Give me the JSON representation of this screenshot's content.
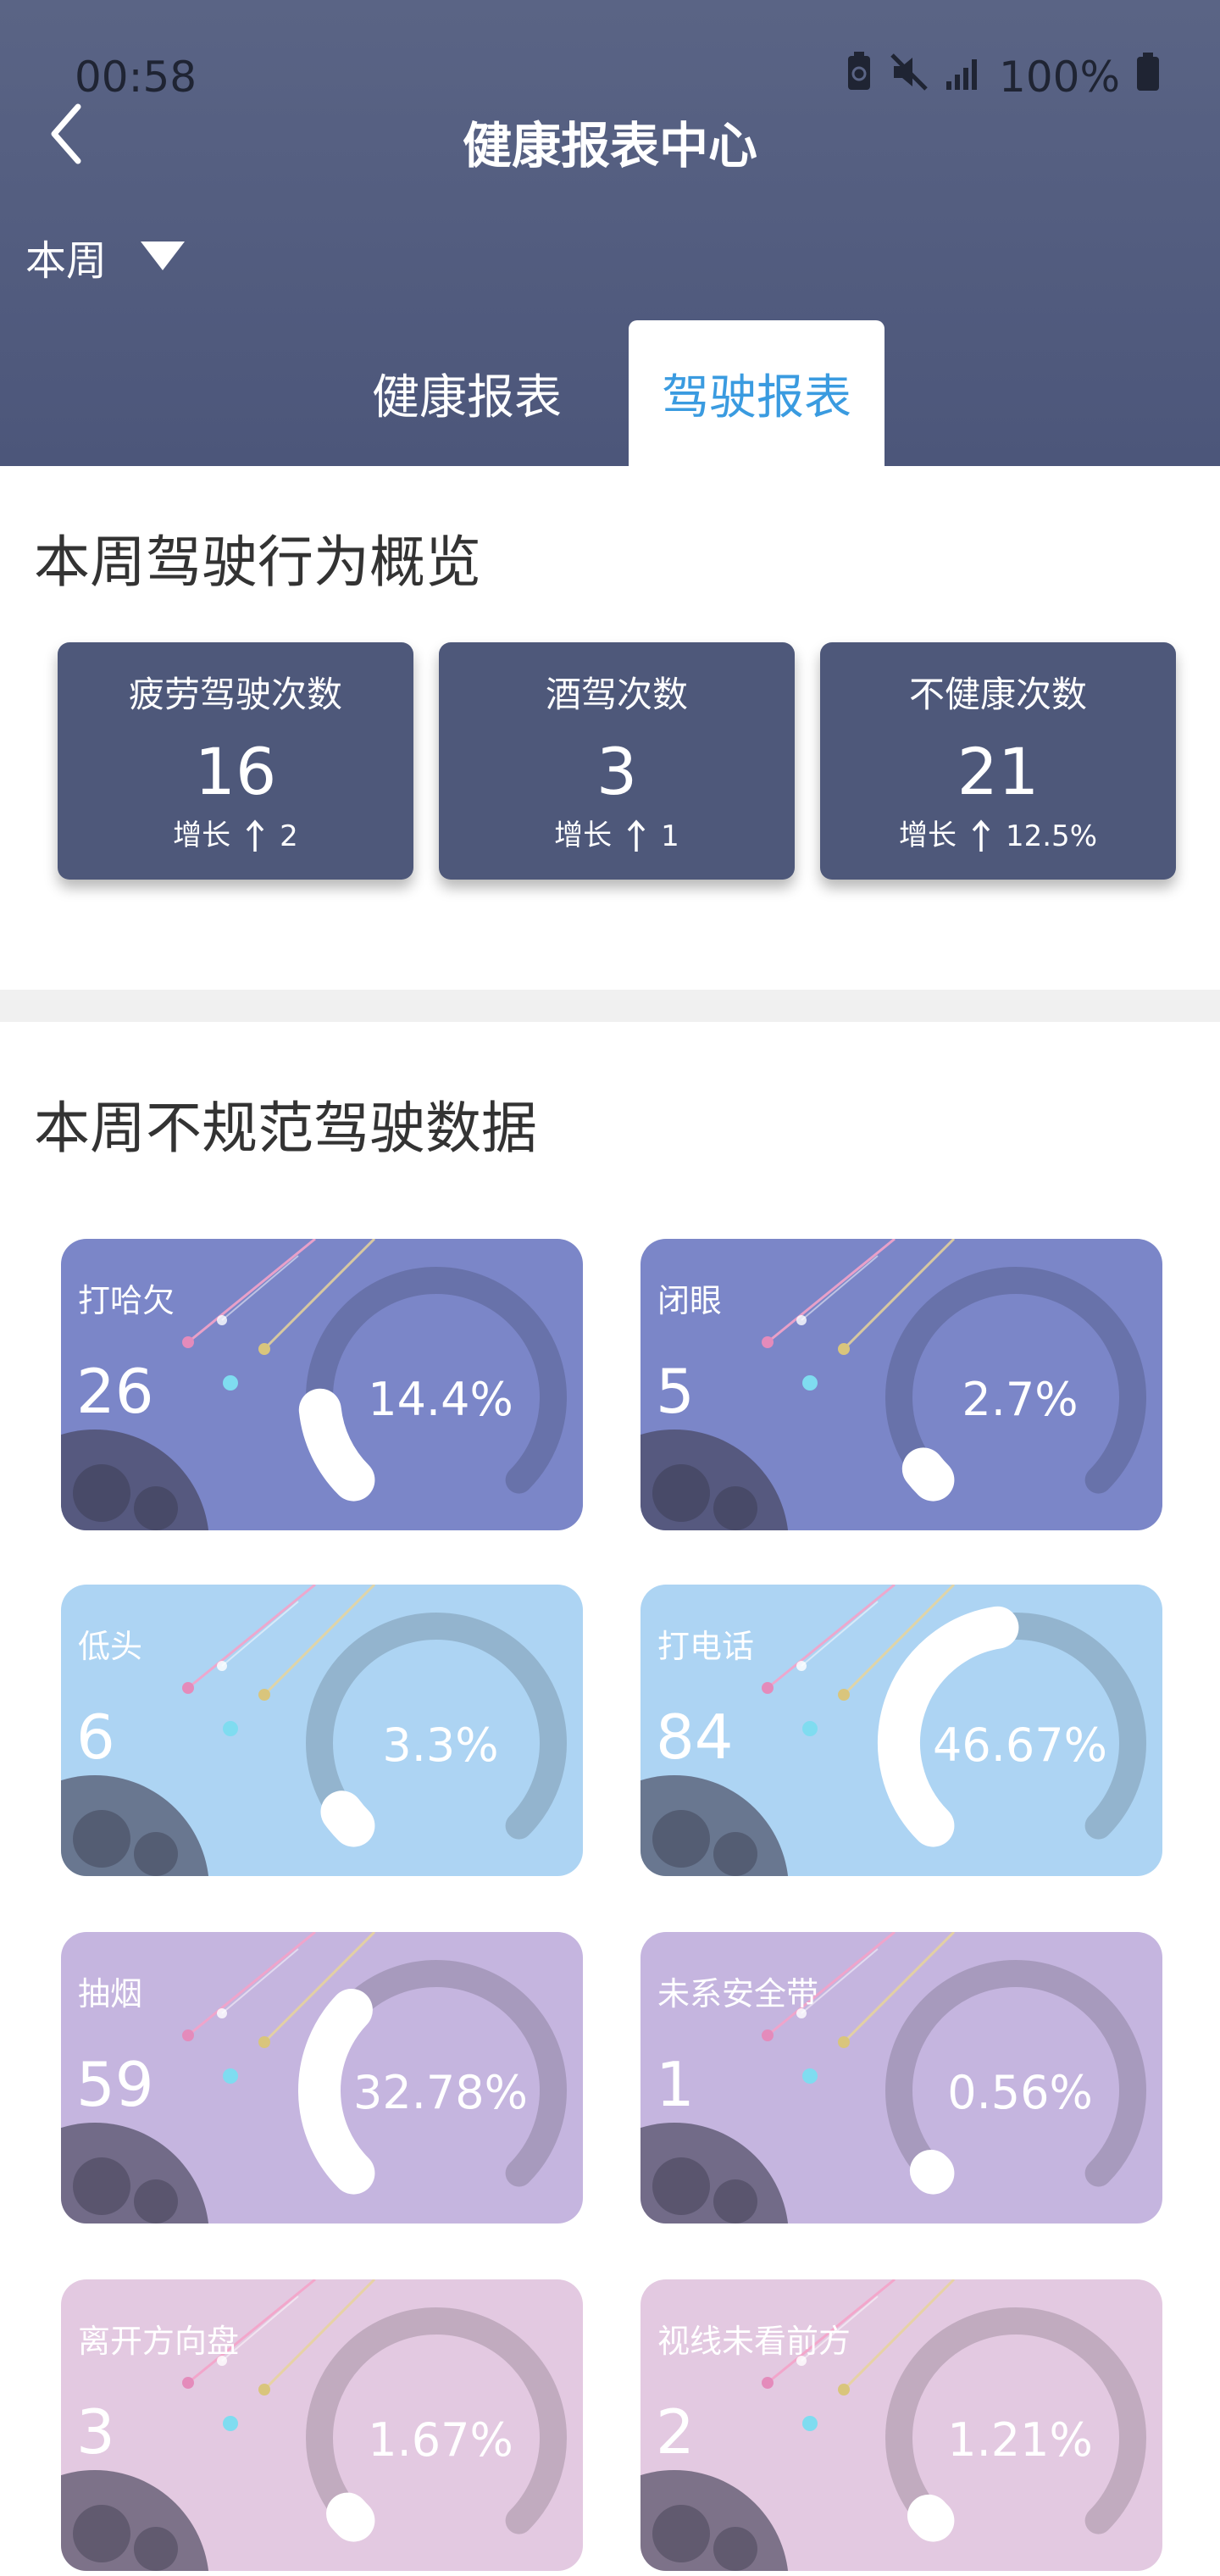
{
  "status": {
    "time": "00:58",
    "battery": "100%"
  },
  "header": {
    "title": "健康报表中心",
    "period": "本周"
  },
  "tabs": [
    {
      "label": "健康报表"
    },
    {
      "label": "驾驶报表"
    }
  ],
  "overview": {
    "title": "本周驾驶行为概览",
    "growth_label": "增长",
    "cards": [
      {
        "label": "疲劳驾驶次数",
        "value": "16",
        "growth": "2"
      },
      {
        "label": "酒驾次数",
        "value": "3",
        "growth": "1"
      },
      {
        "label": "不健康次数",
        "value": "21",
        "growth": "12.5%"
      }
    ]
  },
  "irregular": {
    "title": "本周不规范驾驶数据",
    "cards": [
      {
        "label": "打哈欠",
        "count": "26",
        "percent": "14.4%",
        "ratio": 0.144,
        "theme": "#7b86c8"
      },
      {
        "label": "闭眼",
        "count": "5",
        "percent": "2.7%",
        "ratio": 0.027,
        "theme": "#7b86c8"
      },
      {
        "label": "低头",
        "count": "6",
        "percent": "3.3%",
        "ratio": 0.033,
        "theme": "#add4f3"
      },
      {
        "label": "打电话",
        "count": "84",
        "percent": "46.67%",
        "ratio": 0.4667,
        "theme": "#add4f3"
      },
      {
        "label": "抽烟",
        "count": "59",
        "percent": "32.78%",
        "ratio": 0.3278,
        "theme": "#c5b5df"
      },
      {
        "label": "未系安全带",
        "count": "1",
        "percent": "0.56%",
        "ratio": 0.0056,
        "theme": "#c5b5df"
      },
      {
        "label": "离开方向盘",
        "count": "3",
        "percent": "1.67%",
        "ratio": 0.0167,
        "theme": "#e3c9e1"
      },
      {
        "label": "视线未看前方",
        "count": "2",
        "percent": "1.21%",
        "ratio": 0.0121,
        "theme": "#e3c9e1"
      }
    ]
  }
}
